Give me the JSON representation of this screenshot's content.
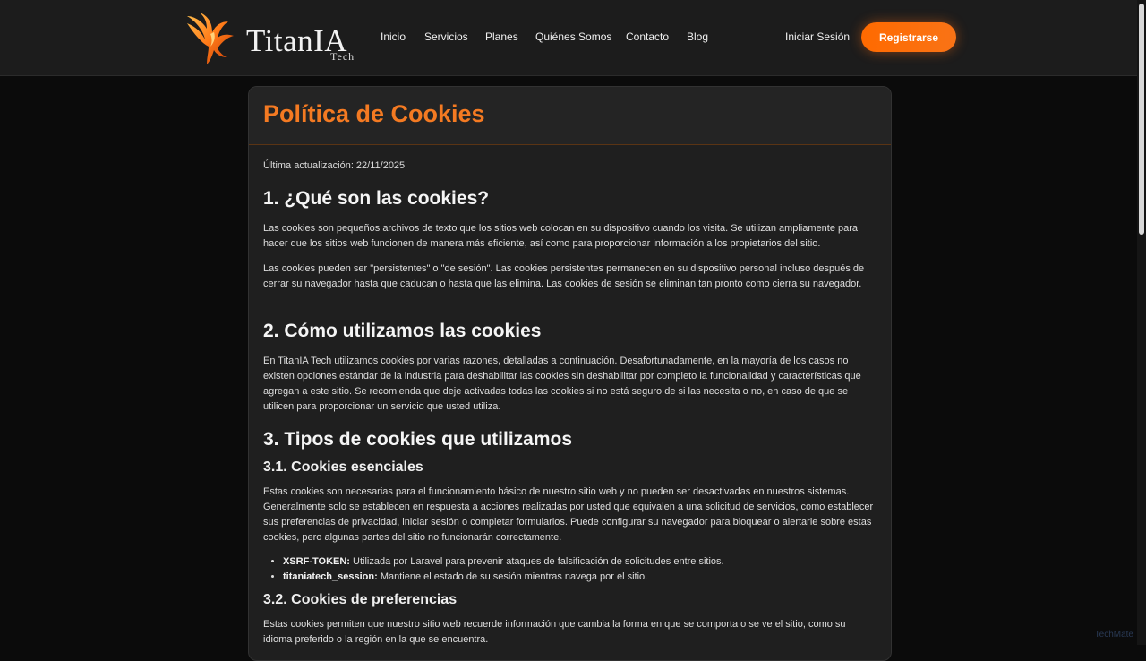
{
  "header": {
    "brand": "TitanIA",
    "brand_sub": "Tech",
    "nav": [
      {
        "label": "Inicio"
      },
      {
        "label": "Servicios"
      },
      {
        "label": "Planes"
      },
      {
        "label": "Quiénes Somos"
      },
      {
        "label": "Contacto"
      },
      {
        "label": "Blog"
      }
    ],
    "login": "Iniciar Sesión",
    "register": "Registrarse",
    "accent": "#F97316"
  },
  "page": {
    "title": "Política de Cookies",
    "updated": "Última actualización: 22/11/2025",
    "s1_title": "1. ¿Qué son las cookies?",
    "s1_p1": "Las cookies son pequeños archivos de texto que los sitios web colocan en su dispositivo cuando los visita. Se utilizan ampliamente para hacer que los sitios web funcionen de manera más eficiente, así como para proporcionar información a los propietarios del sitio.",
    "s1_p2": "Las cookies pueden ser \"persistentes\" o \"de sesión\". Las cookies persistentes permanecen en su dispositivo personal incluso después de cerrar su navegador hasta que caducan o hasta que las elimina. Las cookies de sesión se eliminan tan pronto como cierra su navegador.",
    "s2_title": "2. Cómo utilizamos las cookies",
    "s2_p1": "En TitanIA Tech utilizamos cookies por varias razones, detalladas a continuación. Desafortunadamente, en la mayoría de los casos no existen opciones estándar de la industria para deshabilitar las cookies sin deshabilitar por completo la funcionalidad y características que agregan a este sitio. Se recomienda que deje activadas todas las cookies si no está seguro de si las necesita o no, en caso de que se utilicen para proporcionar un servicio que usted utiliza.",
    "s3_title": "3. Tipos de cookies que utilizamos",
    "s31_title": "3.1. Cookies esenciales",
    "s31_p1": "Estas cookies son necesarias para el funcionamiento básico de nuestro sitio web y no pueden ser desactivadas en nuestros sistemas. Generalmente solo se establecen en respuesta a acciones realizadas por usted que equivalen a una solicitud de servicios, como establecer sus preferencias de privacidad, iniciar sesión o completar formularios. Puede configurar su navegador para bloquear o alertarle sobre estas cookies, pero algunas partes del sitio no funcionarán correctamente.",
    "cookies": [
      {
        "name": "XSRF-TOKEN:",
        "desc": " Utilizada por Laravel para prevenir ataques de falsificación de solicitudes entre sitios."
      },
      {
        "name": "titaniatech_session:",
        "desc": " Mantiene el estado de su sesión mientras navega por el sitio."
      }
    ],
    "s32_title": "3.2. Cookies de preferencias",
    "s32_p1": "Estas cookies permiten que nuestro sitio web recuerde información que cambia la forma en que se comporta o se ve el sitio, como su idioma preferido o la región en la que se encuentra."
  },
  "watermark": "TechMate"
}
